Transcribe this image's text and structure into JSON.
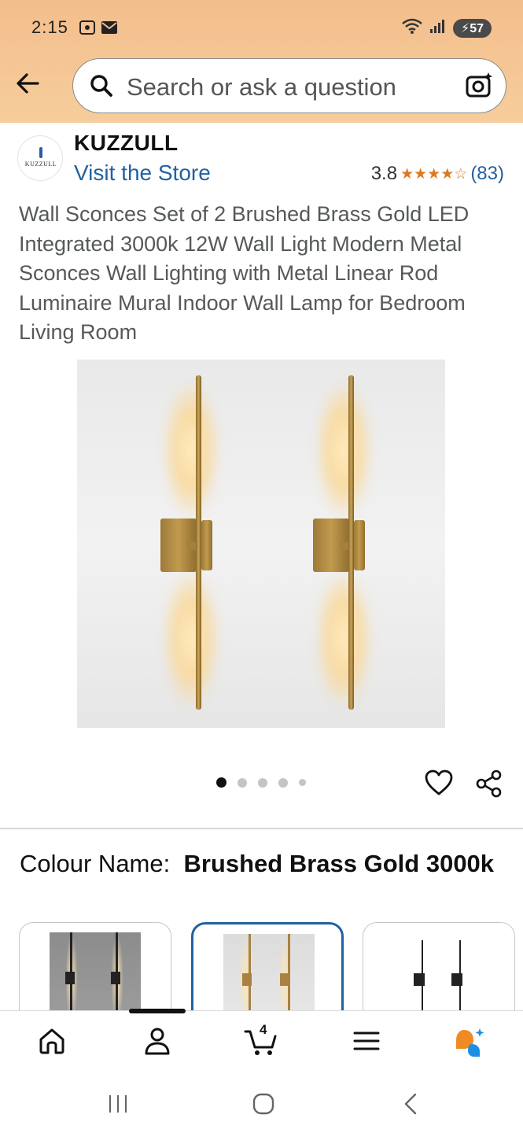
{
  "status_bar": {
    "time": "2:15",
    "battery": "57"
  },
  "search": {
    "placeholder": "Search or ask a question"
  },
  "brand": {
    "logo_text": "KUZZULL",
    "name": "KUZZULL",
    "visit_store": "Visit the Store",
    "rating_value": "3.8",
    "rating_stars": 3.8,
    "rating_count": "(83)"
  },
  "product": {
    "title": "Wall Sconces Set of 2 Brushed Brass Gold LED Integrated 3000k 12W Wall Light Modern Metal Sconces Wall Lighting with Metal Linear Rod Luminaire Mural Indoor Wall Lamp for Bedroom Living Room"
  },
  "gallery": {
    "image_count": 5,
    "active_index": 0
  },
  "colour": {
    "label": "Colour Name:",
    "value": "Brushed Brass Gold 3000k",
    "swatches": [
      {
        "name": "black-warm",
        "selected": false
      },
      {
        "name": "brushed-brass-gold-3000k",
        "selected": true
      },
      {
        "name": "black",
        "selected": false
      }
    ]
  },
  "nav": {
    "cart_count": "4"
  },
  "colors": {
    "accent_link": "#2162a1",
    "star": "#de7921",
    "header_bg": "#f3be8c"
  }
}
